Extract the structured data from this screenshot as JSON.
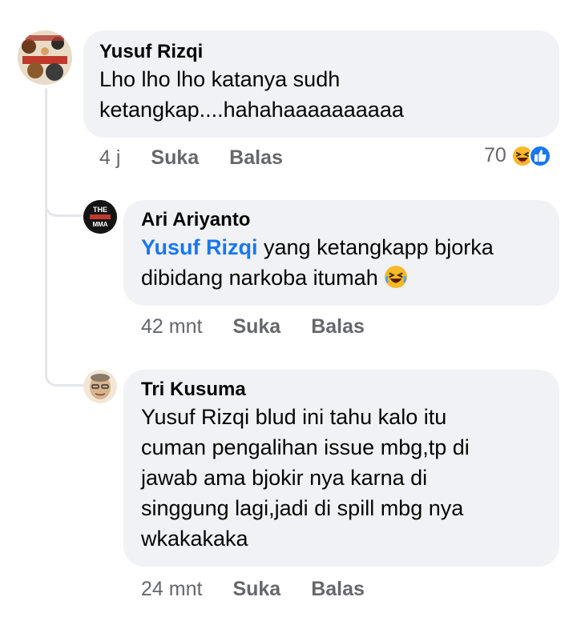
{
  "comments": [
    {
      "author": "Yusuf Rizqi",
      "text_line1": "Lho lho lho katanya sudh",
      "text_line2": "ketangkap....hahahaaaaaaaaaa",
      "time": "4 j",
      "like_label": "Suka",
      "reply_label": "Balas",
      "reaction_count": "70",
      "reactions": [
        "laugh-emoji",
        "like-icon"
      ]
    },
    {
      "author": "Ari Ariyanto",
      "mention": "Yusuf Rizqi",
      "text_line1_rest": " yang ketangkapp bjorka",
      "text_line2": "dibidang narkoba itumah",
      "time": "42 mnt",
      "like_label": "Suka",
      "reply_label": "Balas",
      "avatar_text": [
        "THE",
        "MMA"
      ]
    },
    {
      "author": "Tri Kusuma",
      "text_lines": [
        "Yusuf Rizqi blud ini tahu kalo itu",
        "cuman pengalihan issue mbg,tp di",
        "jawab ama bjokir nya karna di",
        "singgung lagi,jadi di spill mbg nya",
        "wkakakaka"
      ],
      "time": "24 mnt",
      "like_label": "Suka",
      "reply_label": "Balas"
    }
  ],
  "colors": {
    "bubble": "#f0f2f5",
    "meta": "#65676b",
    "mention": "#1877f2",
    "like_blue": "#1877f2"
  }
}
